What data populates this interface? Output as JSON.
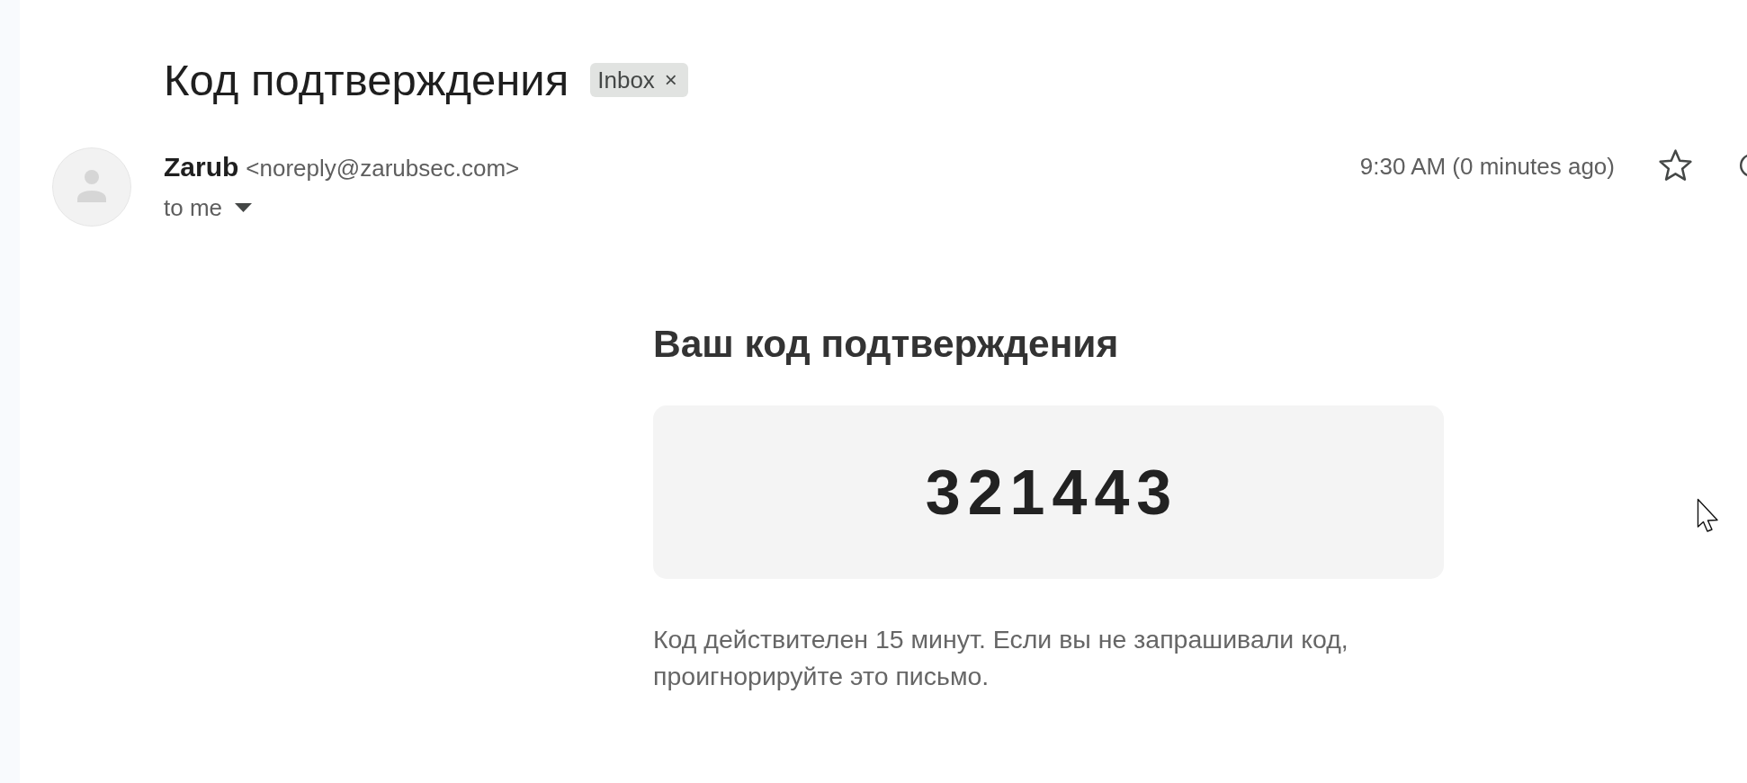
{
  "message": {
    "subject": "Код подтверждения",
    "labels": [
      {
        "name": "Inbox",
        "remove_glyph": "×"
      }
    ],
    "sender": {
      "name": "Zarub",
      "email": "<noreply@zarubsec.com>"
    },
    "recipients": "to me",
    "time": "9:30 AM (0 minutes ago)",
    "starred": false
  },
  "body": {
    "heading": "Ваш код подтверждения",
    "code": "321443",
    "note": "Код действителен 15 минут. Если вы не запрашивали код, проигнорируйте это письмо."
  }
}
